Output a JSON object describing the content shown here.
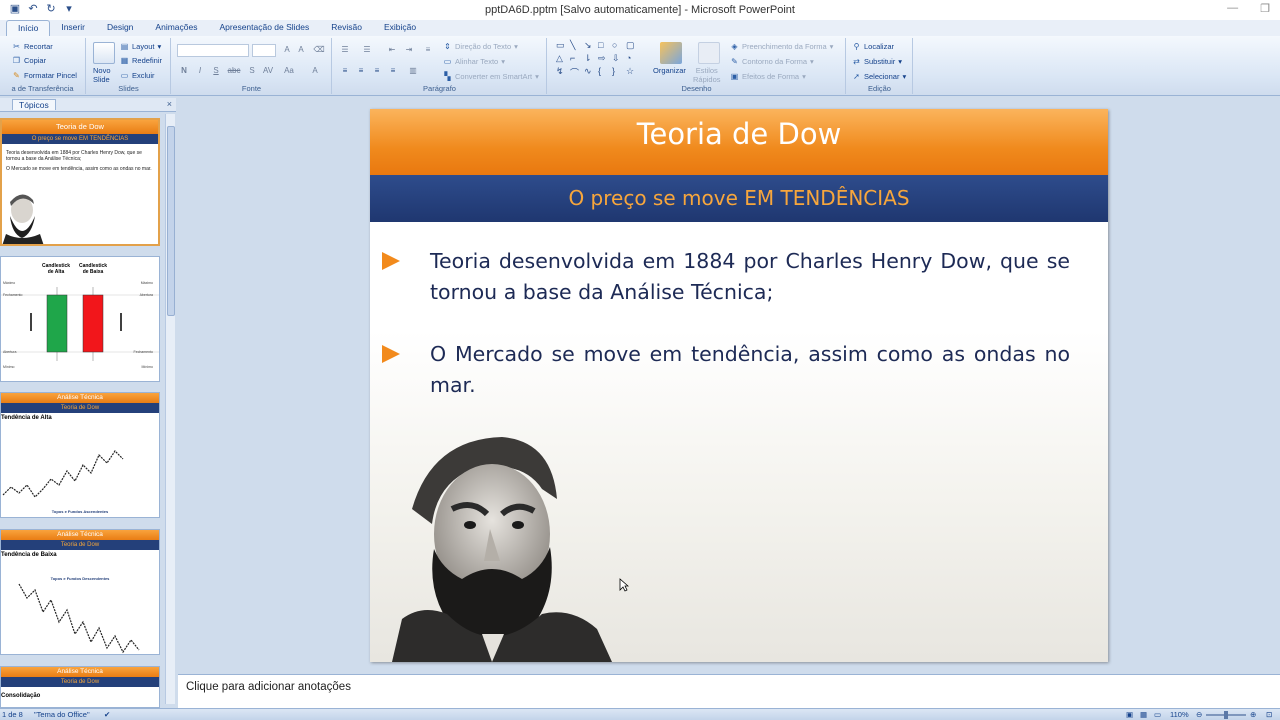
{
  "window": {
    "title": "pptDA6D.pptm [Salvo automaticamente] - Microsoft PowerPoint"
  },
  "ribbon_tabs": [
    "Início",
    "Inserir",
    "Design",
    "Animações",
    "Apresentação de Slides",
    "Revisão",
    "Exibição"
  ],
  "ribbon": {
    "clipboard": {
      "cut": "Recortar",
      "copy": "Copiar",
      "format_painter": "Formatar Pincel",
      "label": "a de Transferência"
    },
    "slides": {
      "new_slide_line1": "Novo",
      "new_slide_line2": "Slide",
      "layout": "Layout",
      "reset": "Redefinir",
      "delete": "Excluir",
      "label": "Slides"
    },
    "font": {
      "label": "Fonte",
      "bold": "N",
      "italic": "I",
      "underline": "S",
      "strike": "abc",
      "shadow": "S",
      "spacing": "AV",
      "case": "Aa",
      "color": "A"
    },
    "paragraph": {
      "text_direction": "Direção do Texto",
      "align_text": "Alinhar Texto",
      "smartart": "Converter em SmartArt",
      "label": "Parágrafo"
    },
    "drawing": {
      "arrange": "Organizar",
      "quick_styles_line1": "Estilos",
      "quick_styles_line2": "Rápidos",
      "shape_fill": "Preenchimento da Forma",
      "shape_outline": "Contorno da Forma",
      "shape_effects": "Efeitos de Forma",
      "label": "Desenho"
    },
    "editing": {
      "find": "Localizar",
      "replace": "Substituir",
      "select": "Selecionar",
      "label": "Edição"
    }
  },
  "left_pane": {
    "tab_outline": "Tópicos",
    "thumbs": [
      {
        "title": "Teoria de Dow",
        "subtitle": "O preço se move EM TENDÊNCIAS",
        "text1": "Teoria desenvolvida em 1884 por Charles Henry Dow, que se tornou a base da Análise Técnica;",
        "text2": "O Mercado se move em tendência, assim como as ondas no mar."
      },
      {
        "col1_line1": "Candlestick",
        "col1_line2": "de Alta",
        "col2_line1": "Candlestick",
        "col2_line2": "de Baixa",
        "max_left": "Máximo",
        "max_right": "Máximo",
        "open_left": "Fechamento",
        "open_right": "Abertura",
        "close_left": "Abertura",
        "close_right": "Fechamento",
        "min_left": "Mínimo",
        "min_right": "Mínimo"
      },
      {
        "title": "Análise Técnica",
        "subtitle": "Teoria de Dow",
        "label": "Tendência de Alta",
        "caption": "Topos e Fundos Ascendentes"
      },
      {
        "title": "Análise Técnica",
        "subtitle": "Teoria de Dow",
        "label": "Tendência de Baixa",
        "caption": "Topos e Fundos Descendentes"
      },
      {
        "title": "Análise Técnica",
        "subtitle": "Teoria de Dow",
        "label": "Consolidação"
      }
    ]
  },
  "slide": {
    "title": "Teoria de Dow",
    "subtitle": "O preço se move EM TENDÊNCIAS",
    "bullets": [
      "Teoria desenvolvida em 1884 por Charles Henry  Dow, que se tornou a base da Análise Técnica;",
      "O Mercado se move em tendência, assim como as ondas no mar."
    ]
  },
  "notes": {
    "placeholder": "Clique para adicionar anotações"
  },
  "status": {
    "slide_counter": "1 de 8",
    "theme": "\"Tema do Office\"",
    "zoom": "110%"
  },
  "colors": {
    "title_orange": "#f08a1d",
    "subtitle_navy": "#24407a",
    "subtitle_text": "#f7a63c",
    "body_text": "#1d2a55",
    "green_candle": "#1fa64a",
    "red_candle": "#f2161b"
  }
}
